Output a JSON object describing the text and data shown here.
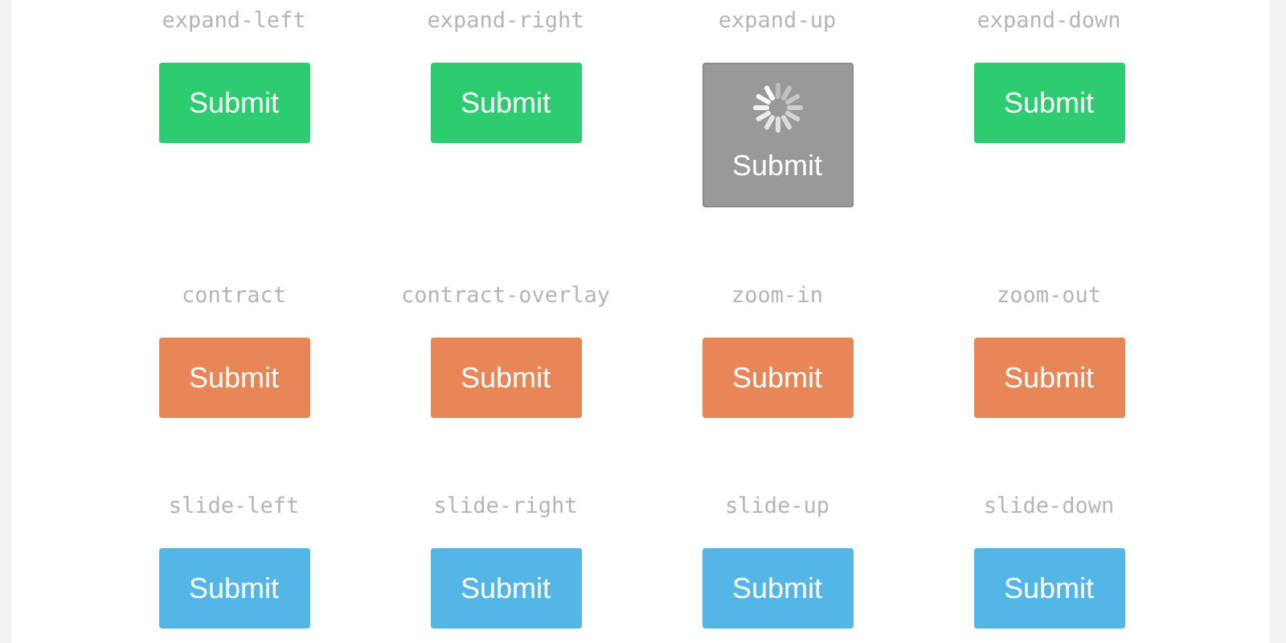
{
  "buttons": [
    {
      "caption": "expand-left",
      "label": "Submit",
      "color": "#2ecc71",
      "loading": false
    },
    {
      "caption": "expand-right",
      "label": "Submit",
      "color": "#2ecc71",
      "loading": false
    },
    {
      "caption": "expand-up",
      "label": "Submit",
      "color": "#999999",
      "loading": true
    },
    {
      "caption": "expand-down",
      "label": "Submit",
      "color": "#2ecc71",
      "loading": false
    },
    {
      "caption": "contract",
      "label": "Submit",
      "color": "#e98658",
      "loading": false
    },
    {
      "caption": "contract-overlay",
      "label": "Submit",
      "color": "#e98658",
      "loading": false
    },
    {
      "caption": "zoom-in",
      "label": "Submit",
      "color": "#e98658",
      "loading": false
    },
    {
      "caption": "zoom-out",
      "label": "Submit",
      "color": "#e98658",
      "loading": false
    },
    {
      "caption": "slide-left",
      "label": "Submit",
      "color": "#54b6e6",
      "loading": false
    },
    {
      "caption": "slide-right",
      "label": "Submit",
      "color": "#54b6e6",
      "loading": false
    },
    {
      "caption": "slide-up",
      "label": "Submit",
      "color": "#54b6e6",
      "loading": false
    },
    {
      "caption": "slide-down",
      "label": "Submit",
      "color": "#54b6e6",
      "loading": false
    }
  ]
}
